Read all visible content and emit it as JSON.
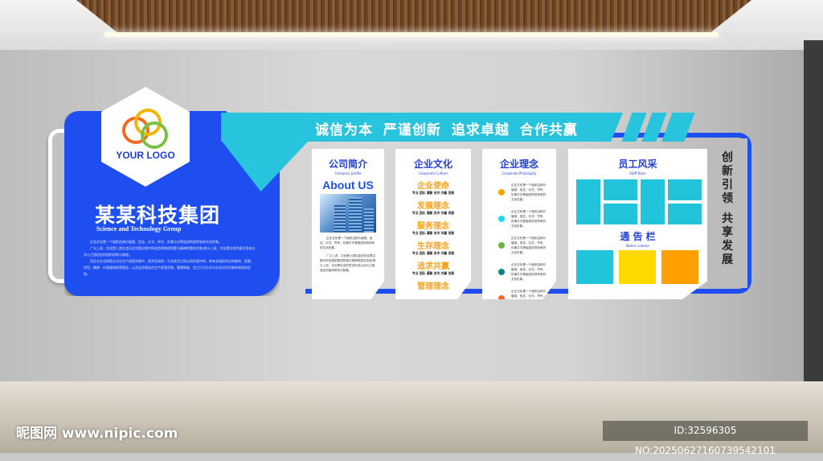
{
  "slogan": "诚信为本  严谨创新  追求卓越  合作共赢",
  "logo": {
    "text": "YOUR LOGO",
    "ring_colors": [
      "#f26b21",
      "#f5b400",
      "#7ac143"
    ]
  },
  "company": {
    "name": "某某科技集团",
    "en": "Science and Technology Group",
    "paragraphs": [
      "企业文化是一个组织由其价值观、信念、仪式、符号、处事方式等组成的其特有的文化形象。",
      "广义上说，文化是人类社会历史实践过程中所创造的物质财富与精神财富的总和;狭义上说，文化是社会的意识形态以及与之相适应的组织机构与制度。",
      "而企业文化则是企业在生产经营实践中，逐步形成的，为全体员工所认同并遵守的，带有本组织特点的使命、愿景、宗旨、精神、价值观和经营理念，以及这些理念在生产经营实践，管理制度、员工行为方式与企业对外形象的体现的总和。"
    ]
  },
  "profile": {
    "title": "公司简介",
    "sub": "Company profile",
    "about": "About US",
    "text1": "企业文化是一个组织由其价值观、信念、仪式、符号、处事方式等组成的其特有的文化形象。",
    "text2": "广义上说，文化是人类社会历史实践过程中所创造的物质财富与精神财富的总和;狭义上说，文化是社会的意识形态以及与之相适应的组织机构与制度。"
  },
  "culture": {
    "title": "企业文化",
    "sub": "Corporate Culture",
    "items": [
      "企业使命",
      "发展理念",
      "服务理念",
      "生存理念",
      "追求共赢",
      "管理理念"
    ],
    "keywords": "专业  团队  凝聚  合作  共赢  发展"
  },
  "philosophy": {
    "title": "企业理念",
    "sub": "Corporate Philosophy",
    "text": "企业文化是一个组织由其价值观、信念、仪式、符号、处事方式等组成的其特有的文化形象。",
    "dot_colors": [
      "#f7a800",
      "#1ed8f0",
      "#6cb33f",
      "#137f8a",
      "#f26522"
    ]
  },
  "staff": {
    "title": "员工风采",
    "sub": "Staff Style",
    "notice_title": "通 告 栏",
    "notice_sub": "Notice column",
    "colors": {
      "tile": "#22c4dc",
      "yellow": "#ffd800",
      "orange": "#ff9f00"
    }
  },
  "vertical": {
    "line1": "创新引领",
    "line2": "共享发展"
  },
  "watermark": {
    "left": "昵图网 www.nipic.com",
    "right": "ID:32596305 NO:20250627160739542101"
  }
}
